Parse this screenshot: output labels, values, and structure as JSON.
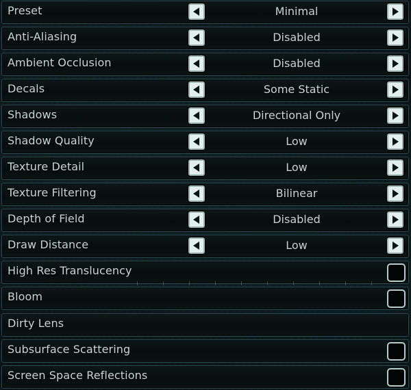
{
  "settings": [
    {
      "label": "Preset",
      "type": "selector",
      "value": "Minimal"
    },
    {
      "label": "Anti-Aliasing",
      "type": "selector",
      "value": "Disabled"
    },
    {
      "label": "Ambient Occlusion",
      "type": "selector",
      "value": "Disabled"
    },
    {
      "label": "Decals",
      "type": "selector",
      "value": "Some Static"
    },
    {
      "label": "Shadows",
      "type": "selector",
      "value": "Directional Only"
    },
    {
      "label": "Shadow Quality",
      "type": "selector",
      "value": "Low"
    },
    {
      "label": "Texture Detail",
      "type": "selector",
      "value": "Low"
    },
    {
      "label": "Texture Filtering",
      "type": "selector",
      "value": "Bilinear"
    },
    {
      "label": "Depth of Field",
      "type": "selector",
      "value": "Disabled"
    },
    {
      "label": "Draw Distance",
      "type": "selector",
      "value": "Low"
    },
    {
      "label": "High Res Translucency",
      "type": "checkbox",
      "checked": false
    },
    {
      "label": "Bloom",
      "type": "checkbox",
      "checked": false
    },
    {
      "label": "Dirty Lens",
      "type": "label"
    },
    {
      "label": "Subsurface Scattering",
      "type": "checkbox",
      "checked": false
    },
    {
      "label": "Screen Space Reflections",
      "type": "checkbox",
      "checked": false
    }
  ],
  "icons": {
    "prev": "triangle-left-icon",
    "next": "triangle-right-icon"
  },
  "colors": {
    "text": "#c9d6d6",
    "row_border": "#2c4a4f",
    "button_face": "#e3eeee",
    "arrow": "#0b1416"
  }
}
